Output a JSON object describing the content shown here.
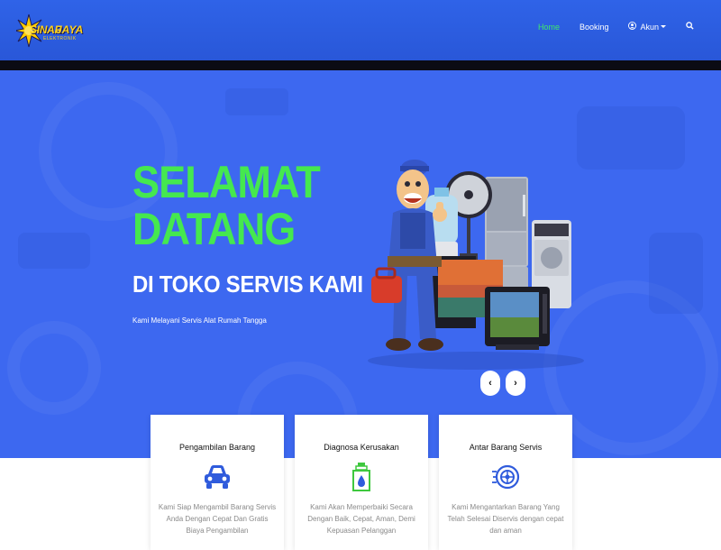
{
  "logo": {
    "word1": "SINAR",
    "word2": "JAYA",
    "tagline": "ELEKTRONIK"
  },
  "nav": {
    "home": "Home",
    "booking": "Booking",
    "account": "Akun",
    "active_color": "#3ee86a",
    "icons": [
      "user-icon",
      "search-icon"
    ]
  },
  "hero": {
    "title": "SELAMAT\nDATANG",
    "subtitle": "DI TOKO SERVIS KAMI",
    "description": "Kami Melayani Servis Alat Rumah Tangga",
    "title_color": "#45e84f",
    "prev_label": "‹",
    "next_label": "›"
  },
  "services": [
    {
      "title": "Pengambilan Barang",
      "icon": "car-icon",
      "text": "Kami Siap Mengambil Barang Servis Anda Dengan Cepat Dan Gratis Biaya Pengambilan"
    },
    {
      "title": "Diagnosa Kerusakan",
      "icon": "oil-can-icon",
      "text": "Kami Akan Memperbaiki Secara Dengan Baik, Cepat, Aman, Demi Kepuasan Pelanggan"
    },
    {
      "title": "Antar Barang Servis",
      "icon": "delivery-wheel-icon",
      "text": "Kami Mengantarkan Barang Yang Telah Selesai Diservis dengan cepat dan aman"
    }
  ],
  "colors": {
    "navbar": "#2f63e8",
    "hero": "#3d68f0",
    "icon_blue": "#2f5bdc",
    "icon_green": "#3ec83e"
  }
}
